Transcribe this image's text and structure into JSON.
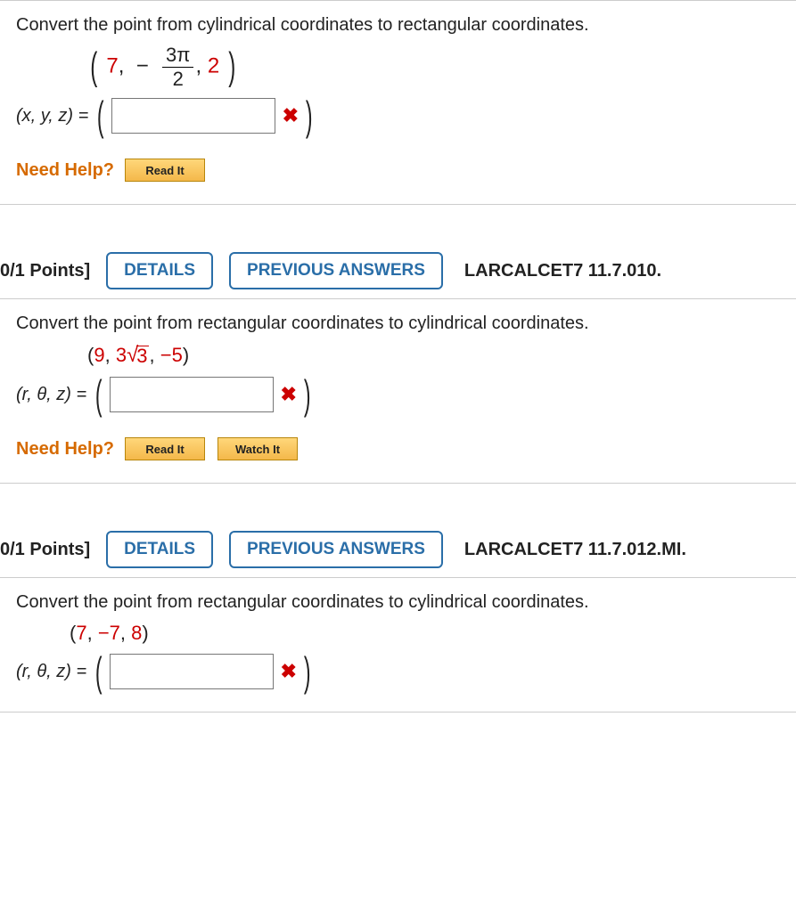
{
  "q1": {
    "prompt": "Convert the point from cylindrical coordinates to rectangular coordinates.",
    "math": {
      "r": "7",
      "theta_num_pi": "3π",
      "theta_den": "2",
      "z": "2"
    },
    "lhs": "(x, y, z) = ",
    "needHelp": "Need Help?",
    "readIt": "Read It"
  },
  "q2": {
    "points": "0/1 Points]",
    "details": "DETAILS",
    "prev": "PREVIOUS ANSWERS",
    "ref": "LARCALCET7 11.7.010.",
    "prompt": "Convert the point from rectangular coordinates to cylindrical coordinates.",
    "coord": {
      "a": "9",
      "b_coeff": "3",
      "b_rad": "3",
      "c": "−5"
    },
    "lhs": "(r, θ, z) = ",
    "needHelp": "Need Help?",
    "readIt": "Read It",
    "watchIt": "Watch It"
  },
  "q3": {
    "points": "0/1 Points]",
    "details": "DETAILS",
    "prev": "PREVIOUS ANSWERS",
    "ref": "LARCALCET7 11.7.012.MI.",
    "prompt": "Convert the point from rectangular coordinates to cylindrical coordinates.",
    "coord": {
      "a": "7",
      "b": "−7",
      "c": "8"
    },
    "lhs": "(r, θ, z) = "
  },
  "chart_data": [
    {
      "type": "table",
      "title": "Q1 cylindrical coordinates",
      "columns": [
        "r",
        "theta",
        "z"
      ],
      "rows": [
        [
          "7",
          "-3π/2",
          "2"
        ]
      ]
    },
    {
      "type": "table",
      "title": "Q2 rectangular coordinates",
      "columns": [
        "x",
        "y",
        "z"
      ],
      "rows": [
        [
          "9",
          "3√3",
          "-5"
        ]
      ]
    },
    {
      "type": "table",
      "title": "Q3 rectangular coordinates",
      "columns": [
        "x",
        "y",
        "z"
      ],
      "rows": [
        [
          "7",
          "-7",
          "8"
        ]
      ]
    }
  ]
}
